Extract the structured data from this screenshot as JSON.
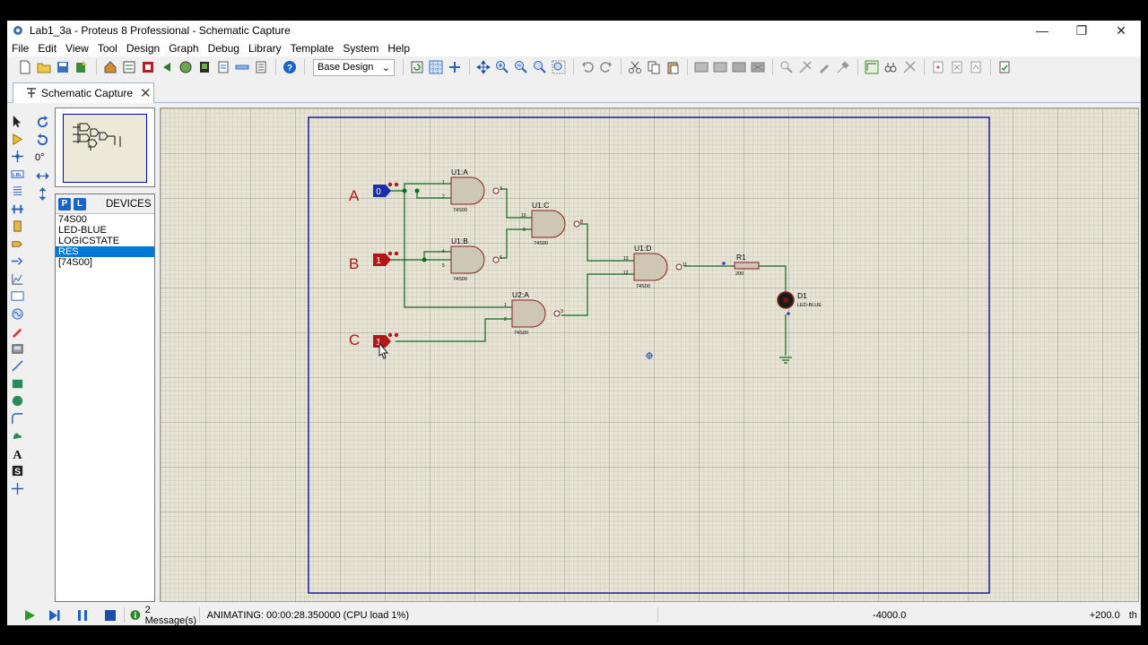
{
  "window": {
    "title": "Lab1_3a - Proteus 8 Professional - Schematic Capture",
    "minimize": "—",
    "maximize": "❐",
    "close": "✕"
  },
  "menu": [
    "File",
    "Edit",
    "View",
    "Tool",
    "Design",
    "Graph",
    "Debug",
    "Library",
    "Template",
    "System",
    "Help"
  ],
  "toolbar": {
    "design_select": "Base Design"
  },
  "tab": {
    "label": "Schematic Capture",
    "close": "✕"
  },
  "rotation": {
    "angle": "0°"
  },
  "device_panel": {
    "p_label": "P",
    "l_label": "L",
    "title": "DEVICES",
    "items": [
      "74S00",
      "LED-BLUE",
      "LOGICSTATE",
      "RES",
      "[74S00]"
    ],
    "selected_index": 3
  },
  "schematic": {
    "inputs": [
      {
        "label": "A",
        "state": "0",
        "color": "#1c2fa8"
      },
      {
        "label": "B",
        "state": "1",
        "color": "#b01818"
      },
      {
        "label": "C",
        "state": "1",
        "color": "#b01818"
      }
    ],
    "gates": [
      {
        "ref": "U1:A",
        "type": "74S00",
        "pins": [
          "1",
          "2",
          "3"
        ]
      },
      {
        "ref": "U1:B",
        "type": "74S00",
        "pins": [
          "4",
          "5",
          "6"
        ]
      },
      {
        "ref": "U1:C",
        "type": "74S00",
        "pins": [
          "10",
          "9",
          "8"
        ]
      },
      {
        "ref": "U2:A",
        "type": "74S00",
        "pins": [
          "1",
          "2",
          "3"
        ]
      },
      {
        "ref": "U1:D",
        "type": "74S00",
        "pins": [
          "13",
          "12",
          "11"
        ]
      }
    ],
    "resistor": {
      "ref": "R1",
      "value": "200"
    },
    "led": {
      "ref": "D1",
      "type": "LED-BLUE"
    }
  },
  "status": {
    "messages": "2 Message(s)",
    "animating": "ANIMATING: 00:00:28.350000 (CPU load 1%)",
    "coord_x": "-4000.0",
    "coord_y": "+200.0",
    "units": "th"
  },
  "colors": {
    "wire": "#0f6b1f",
    "gate_fill": "#cfc7b5",
    "gate_stroke": "#8a1f1f",
    "sheet_border": "#1a1aa8",
    "canvas_bg": "#e7e4d6"
  }
}
